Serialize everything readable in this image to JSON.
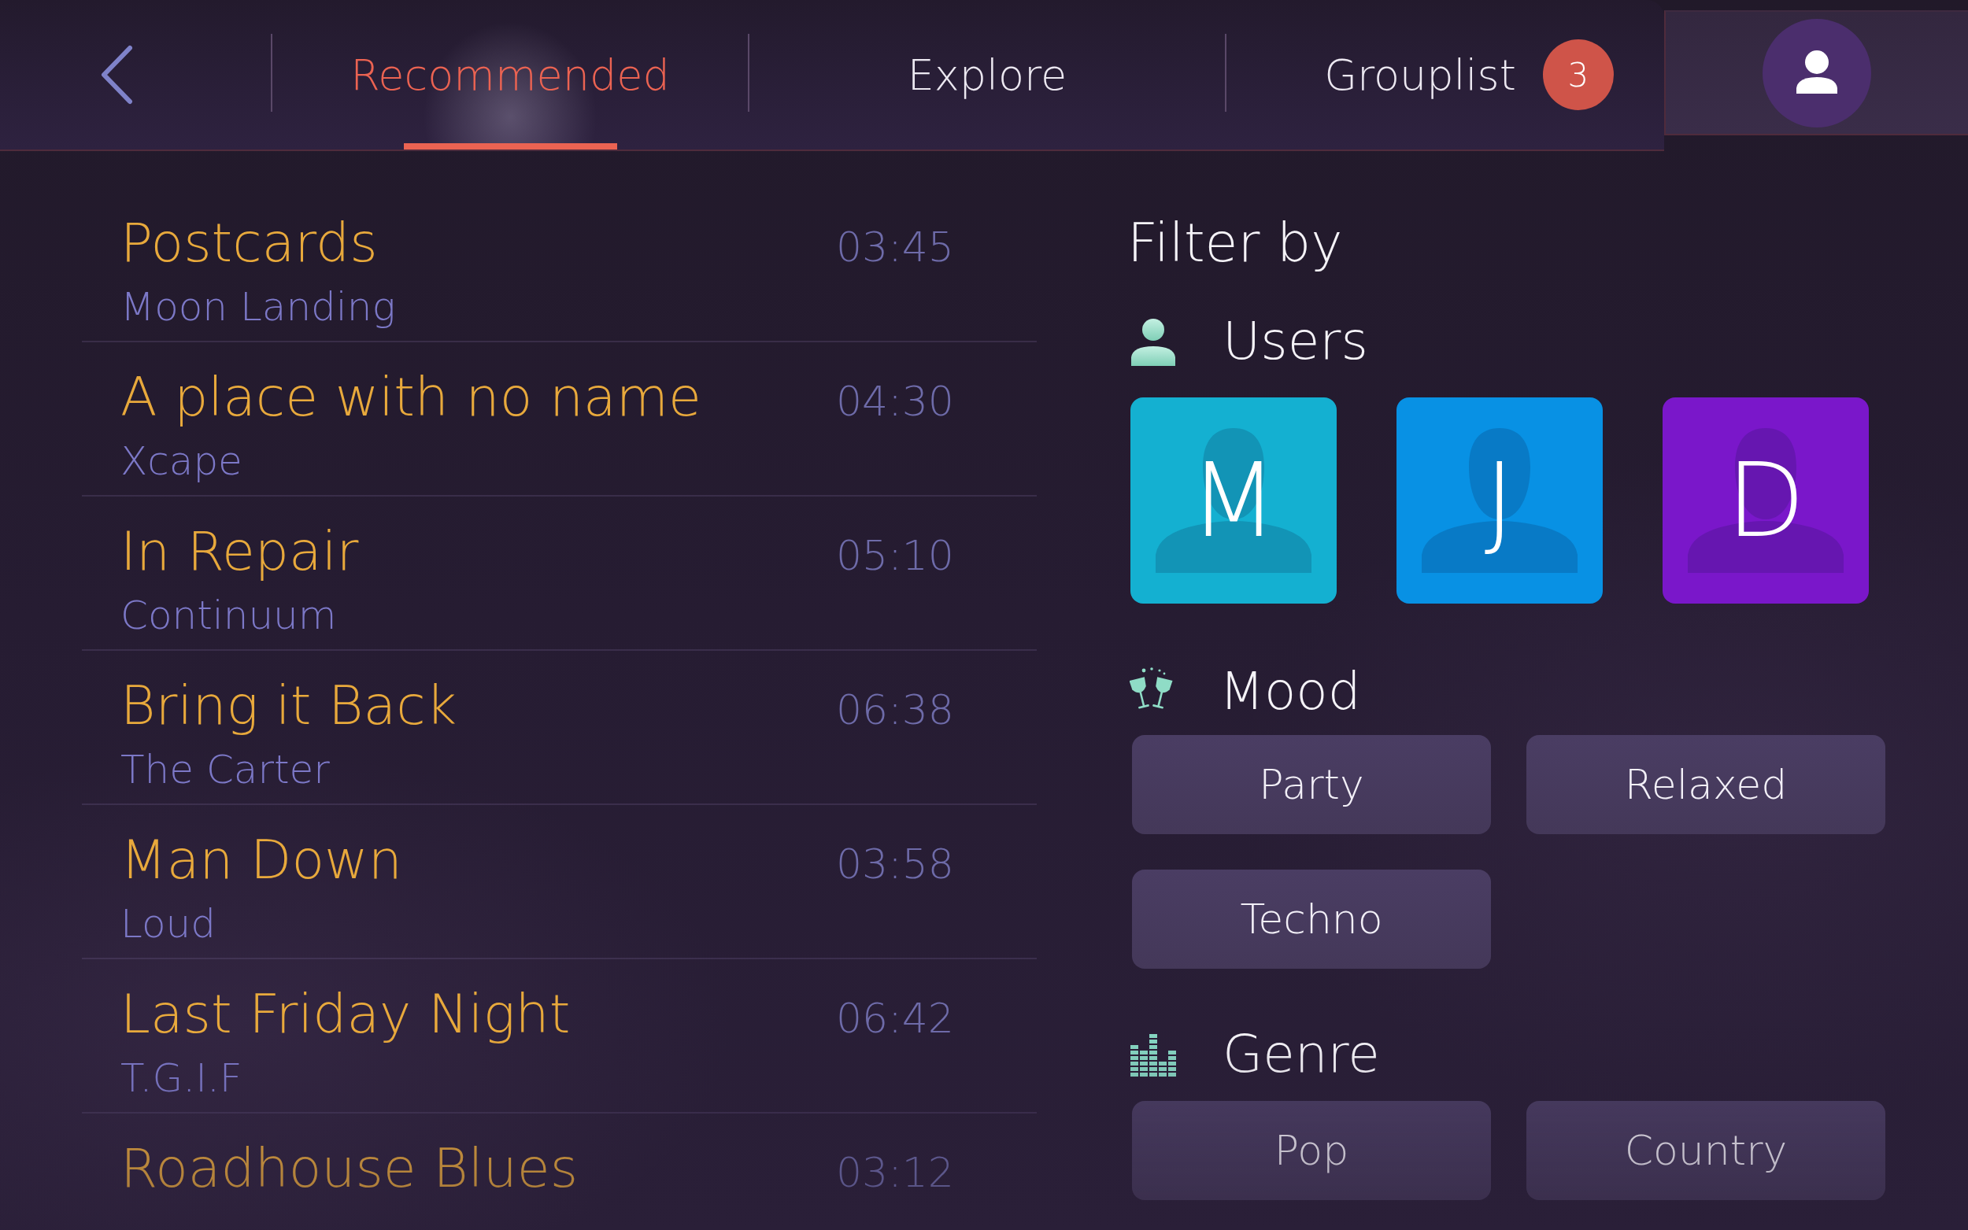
{
  "top_bar": {
    "tabs": [
      {
        "label": "Recommended",
        "selected": true
      },
      {
        "label": "Explore",
        "selected": false
      },
      {
        "label": "Grouplist",
        "selected": false,
        "badge": "3"
      }
    ]
  },
  "tracks": [
    {
      "title": "Postcards",
      "artist": "Moon Landing",
      "duration": "03:45"
    },
    {
      "title": "A place with no name",
      "artist": "Xcape",
      "duration": "04:30"
    },
    {
      "title": "In Repair",
      "artist": "Continuum",
      "duration": "05:10"
    },
    {
      "title": "Bring it Back",
      "artist": "The Carter",
      "duration": "06:38"
    },
    {
      "title": "Man Down",
      "artist": "Loud",
      "duration": "03:58"
    },
    {
      "title": "Last Friday Night",
      "artist": "T.G.I.F",
      "duration": "06:42"
    },
    {
      "title": "Roadhouse Blues",
      "duration": "03:12"
    }
  ],
  "filter": {
    "title": "Filter by",
    "users": {
      "heading": "Users",
      "items": [
        {
          "initial": "M",
          "color": "#14b0d1"
        },
        {
          "initial": "J",
          "color": "#0891e4"
        },
        {
          "initial": "D",
          "color": "#7a17ca"
        }
      ]
    },
    "mood": {
      "heading": "Mood",
      "options": [
        {
          "label": "Party",
          "selected": false
        },
        {
          "label": "Relaxed",
          "selected": false
        },
        {
          "label": "Techno",
          "selected": false
        }
      ]
    },
    "genre": {
      "heading": "Genre",
      "options": [
        {
          "label": "Pop",
          "selected": false
        },
        {
          "label": "Country",
          "selected": false
        }
      ]
    }
  }
}
